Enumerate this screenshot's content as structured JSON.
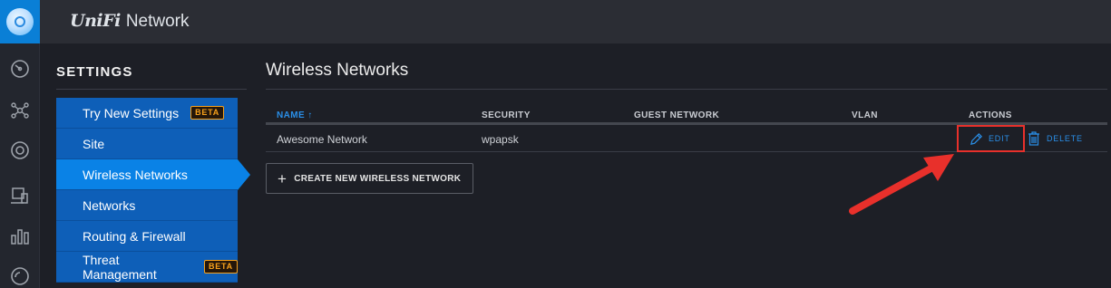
{
  "app": {
    "brand_unifi": "UniFi",
    "brand_network": "Network"
  },
  "rail": {
    "icons": [
      "dashboard-icon",
      "topology-icon",
      "devices-icon",
      "clients-icon",
      "statistics-icon",
      "insights-icon"
    ]
  },
  "settings": {
    "title": "SETTINGS",
    "items": [
      {
        "label": "Try New Settings",
        "badge": "BETA"
      },
      {
        "label": "Site"
      },
      {
        "label": "Wireless Networks",
        "active": true
      },
      {
        "label": "Networks"
      },
      {
        "label": "Routing & Firewall"
      },
      {
        "label": "Threat Management",
        "badge": "BETA"
      }
    ]
  },
  "main": {
    "title": "Wireless Networks",
    "table": {
      "columns": [
        "NAME ↑",
        "SECURITY",
        "GUEST NETWORK",
        "VLAN",
        "ACTIONS"
      ],
      "rows": [
        {
          "name": "Awesome Network",
          "security": "wpapsk",
          "guest": "",
          "vlan": ""
        }
      ]
    },
    "actions": {
      "edit": "EDIT",
      "delete": "DELETE"
    },
    "create_button": "CREATE NEW WIRELESS NETWORK"
  },
  "colors": {
    "accent": "#0a82e6",
    "nav_bg": "#0e5fb8",
    "badge": "#f7a11c",
    "highlight": "#e8302b",
    "link": "#2a8fe8"
  }
}
